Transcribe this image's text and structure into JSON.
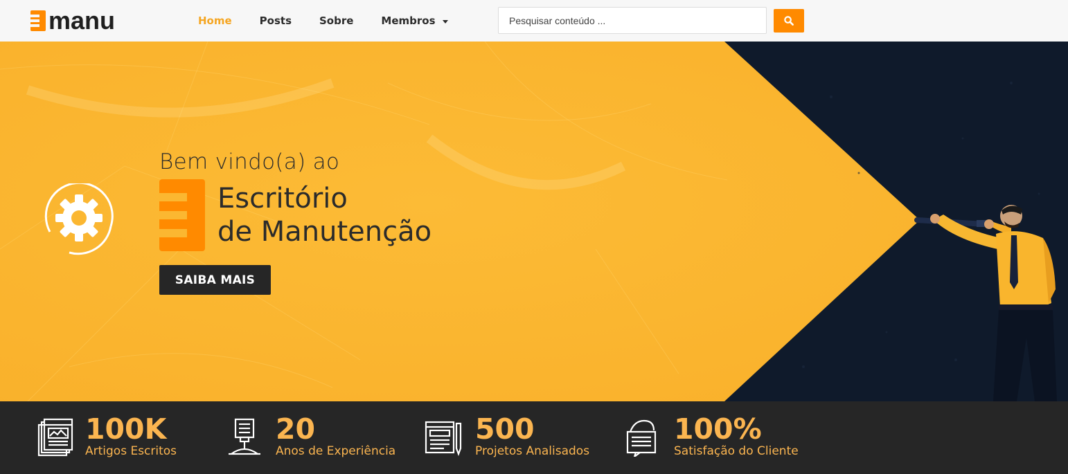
{
  "brand": {
    "logo_text": "manu",
    "accent": "#ff8a00",
    "yellow": "#fbb731",
    "navy": "#0f1a2b"
  },
  "nav": {
    "items": [
      {
        "label": "Home",
        "active": true
      },
      {
        "label": "Posts"
      },
      {
        "label": "Sobre"
      },
      {
        "label": "Membros",
        "dropdown": true
      }
    ]
  },
  "search": {
    "placeholder": "Pesquisar conteúdo ...",
    "value": "",
    "button_icon": "search-icon"
  },
  "hero": {
    "welcome": "Bem vindo(a) ao",
    "title_line1": "Escritório",
    "title_line2": "de Manutenção",
    "cta_label": "SAIBA MAIS",
    "badge_icon": "gear-icon",
    "image": "man-with-telescope"
  },
  "stats": [
    {
      "value": "100K",
      "label": "Artigos Escritos",
      "icon": "articles-icon"
    },
    {
      "value": "20",
      "label": "Anos de Experiência",
      "icon": "experience-icon"
    },
    {
      "value": "500",
      "label": "Projetos Analisados",
      "icon": "projects-icon"
    },
    {
      "value": "100%",
      "label": "Satisfação do Cliente",
      "icon": "satisfaction-icon"
    }
  ]
}
